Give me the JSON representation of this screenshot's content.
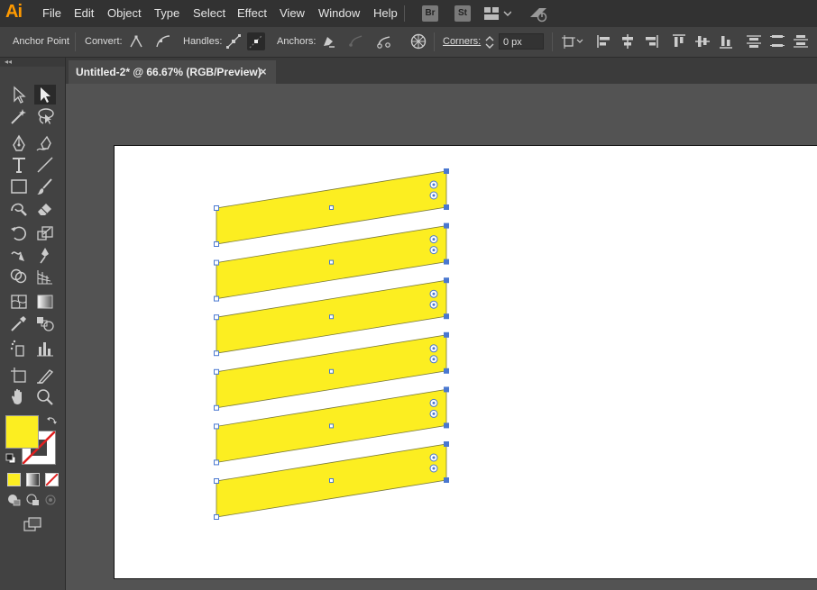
{
  "app": {
    "logo": "Ai",
    "menus": [
      "File",
      "Edit",
      "Object",
      "Type",
      "Select",
      "Effect",
      "View",
      "Window",
      "Help"
    ],
    "bridge_badge": "Br",
    "stock_badge": "St"
  },
  "control_bar": {
    "tool_name": "Anchor Point",
    "convert_label": "Convert:",
    "handles_label": "Handles:",
    "anchors_label": "Anchors:",
    "corners_label": "Corners:",
    "corners_value": "0 px"
  },
  "document": {
    "tab_title": "Untitled-2* @ 66.67% (RGB/Preview)",
    "close_glyph": "×"
  },
  "colors": {
    "fill": "#fcee21",
    "stroke": "none",
    "selection": "#4a78d0"
  },
  "shapes": {
    "count": 6,
    "fill_color": "#fcee21",
    "stroke_color": "#7a7a3a"
  }
}
